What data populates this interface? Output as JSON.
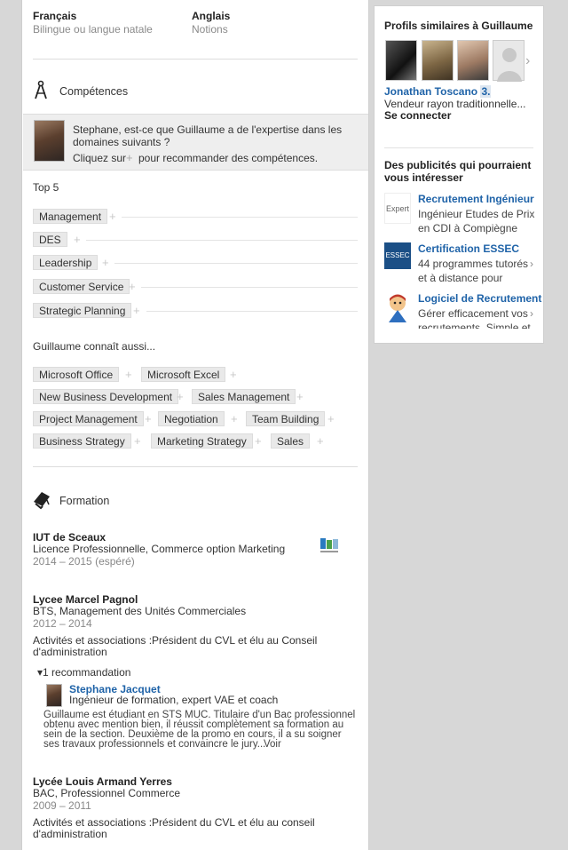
{
  "languages": [
    {
      "name": "Français",
      "level": "Bilingue ou langue natale"
    },
    {
      "name": "Anglais",
      "level": "Notions"
    }
  ],
  "skills": {
    "title": "Compétences",
    "prompt_line1": "Stephane, est-ce que Guillaume a de l'expertise dans les",
    "prompt_line2": "domaines suivants ?",
    "prompt_line3a": "Cliquez sur",
    "prompt_line3b": "pour recommander des compétences.",
    "top5_label": "Top 5",
    "top5": [
      "Management",
      "DES",
      "Leadership",
      "Customer Service",
      "Strategic Planning"
    ],
    "also_label": "Guillaume connaît aussi...",
    "also": [
      "Microsoft Office",
      "Microsoft Excel",
      "New Business Development",
      "Sales Management",
      "Project Management",
      "Negotiation",
      "Team Building",
      "Business Strategy",
      "Marketing Strategy",
      "Sales"
    ],
    "plus_glyph": "+"
  },
  "education": {
    "title": "Formation",
    "items": [
      {
        "school": "IUT de Sceaux",
        "degree": "Licence Professionnelle, Commerce option Marketing",
        "dates": "2014 – 2015 (espéré)"
      },
      {
        "school": "Lycee Marcel Pagnol",
        "degree": "BTS, Management des Unités Commerciales",
        "dates": "2012 – 2014",
        "activities_label": "Activités et associations :",
        "activities_line1": "Président du CVL et élu au Conseil",
        "activities_line2": "d'administration"
      },
      {
        "school": "Lycée Louis Armand Yerres",
        "degree": "BAC, Professionnel Commerce",
        "dates": "2009 – 2011",
        "activities_label": "Activités et associations :",
        "activities_line1": "Président du CVL et élu au conseil",
        "activities_line2": "d'administration"
      }
    ],
    "recommendation": {
      "toggle": "1 recommandation",
      "name": "Stephane Jacquet",
      "title": "Ingénieur de formation, expert VAE et coach",
      "text_lines": [
        "Guillaume est étudiant en STS MUC. Titulaire d'un Bac professionnel",
        "obtenu avec mention bien, il réussit complètement sa formation au",
        "sein de la section. Deuxième de la promo en cours, il a su soigner",
        "ses travaux professionnels et convaincre le jury..."
      ],
      "more": "Voir"
    }
  },
  "sidebar": {
    "similar_title": "Profils similaires à Guillaume",
    "person_name": "Jonathan Toscano",
    "person_degree": "3.",
    "person_title": "Vendeur rayon traditionnelle...",
    "connect": "Se connecter",
    "next_arrow": "›",
    "ads_title_line1": "Des publicités qui pourraient",
    "ads_title_line2": "vous intéresser",
    "ads": [
      {
        "title": "Recrutement Ingénieur",
        "line1": "Ingénieur Etudes de Prix",
        "line2": "en CDI à Compiègne",
        "logo": "Expert"
      },
      {
        "title": "Certification ESSEC",
        "line1": "44 programmes tutorés",
        "line2": "et à distance pour",
        "logo": "ESSEC"
      },
      {
        "title": "Logiciel de Recrutement",
        "line1": "Gérer efficacement vos",
        "line2": "recrutements. Simple et",
        "logo": "mascot"
      }
    ],
    "ad_chevron": "›"
  },
  "colors": {
    "link": "#1f63a8",
    "tag_bg": "#e9e9e9",
    "page_bg": "#d7d7d7"
  }
}
